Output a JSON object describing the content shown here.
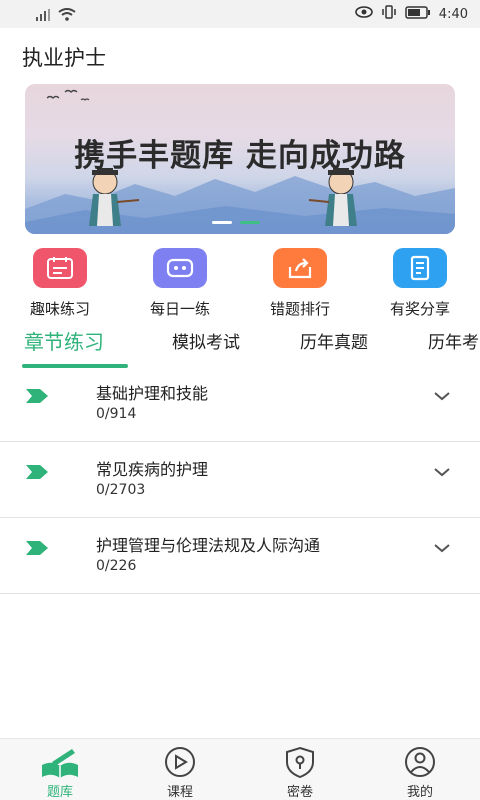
{
  "status_bar": {
    "time": "4:40"
  },
  "app_title": "执业护士",
  "banner": {
    "text": "携手丰题库 走向成功路",
    "active_slide": 2,
    "slide_count": 2
  },
  "quick_actions": [
    {
      "label": "趣味练习",
      "icon": "calendar-list-icon",
      "color": "#f0566b"
    },
    {
      "label": "每日一练",
      "icon": "robot-face-icon",
      "color": "#7e7ff0"
    },
    {
      "label": "错题排行",
      "icon": "share-box-icon",
      "color": "#ff7a3d"
    },
    {
      "label": "有奖分享",
      "icon": "notebook-icon",
      "color": "#2ea1f0"
    }
  ],
  "tabs": [
    {
      "label": "章节练习",
      "active": true
    },
    {
      "label": "模拟考试",
      "active": false
    },
    {
      "label": "历年真题",
      "active": false
    },
    {
      "label": "历年考",
      "active": false
    }
  ],
  "chapters": [
    {
      "title": "基础护理和技能",
      "count": "0/914"
    },
    {
      "title": "常见疾病的护理",
      "count": "0/2703"
    },
    {
      "title": "护理管理与伦理法规及人际沟通",
      "count": "0/226"
    }
  ],
  "bottom_nav": [
    {
      "label": "题库",
      "icon": "book-pen-icon",
      "active": true
    },
    {
      "label": "课程",
      "icon": "play-circle-icon",
      "active": false
    },
    {
      "label": "密卷",
      "icon": "lock-shield-icon",
      "active": false
    },
    {
      "label": "我的",
      "icon": "user-circle-icon",
      "active": false
    }
  ],
  "colors": {
    "accent": "#2fb37a"
  }
}
